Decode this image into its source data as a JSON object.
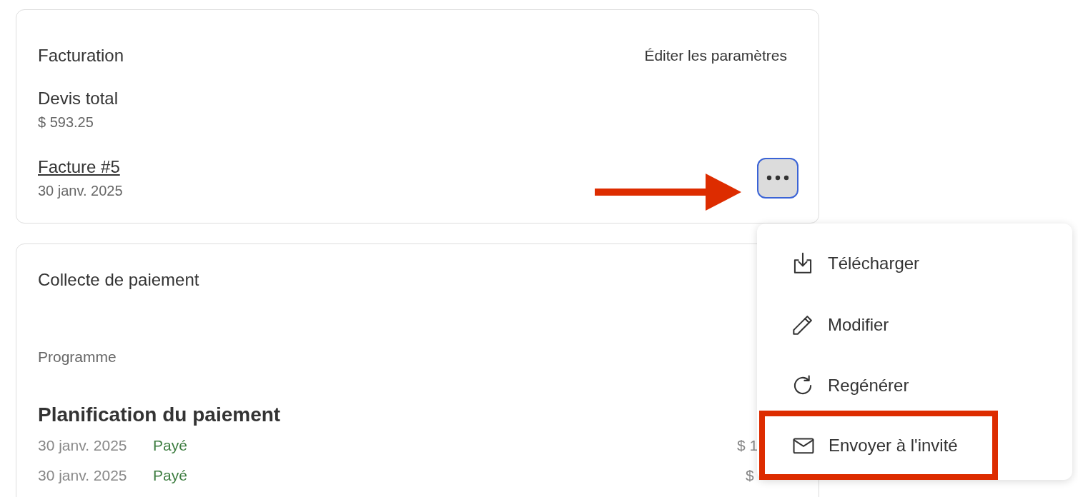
{
  "billing": {
    "title": "Facturation",
    "edit_link": "Éditer les paramètres",
    "total_label": "Devis total",
    "total_value": "$ 593.25",
    "invoice": {
      "label": "Facture #5",
      "date": "30 janv. 2025"
    },
    "more_button": {
      "focused": true
    }
  },
  "payment": {
    "title": "Collecte de paiement",
    "program_label": "Programme",
    "schedule_title": "Planification du paiement",
    "rows": [
      {
        "date": "30 janv. 2025",
        "status": "Payé",
        "amount": "$ 1"
      },
      {
        "date": "30 janv. 2025",
        "status": "Payé",
        "amount": "$"
      }
    ]
  },
  "menu": {
    "items": [
      {
        "kind": "download",
        "label": "Télécharger",
        "highlighted": false
      },
      {
        "kind": "edit",
        "label": "Modifier",
        "highlighted": false
      },
      {
        "kind": "regenerate",
        "label": "Regénérer",
        "highlighted": false
      },
      {
        "kind": "mail",
        "label": "Envoyer à l'invité",
        "highlighted": true
      }
    ]
  }
}
